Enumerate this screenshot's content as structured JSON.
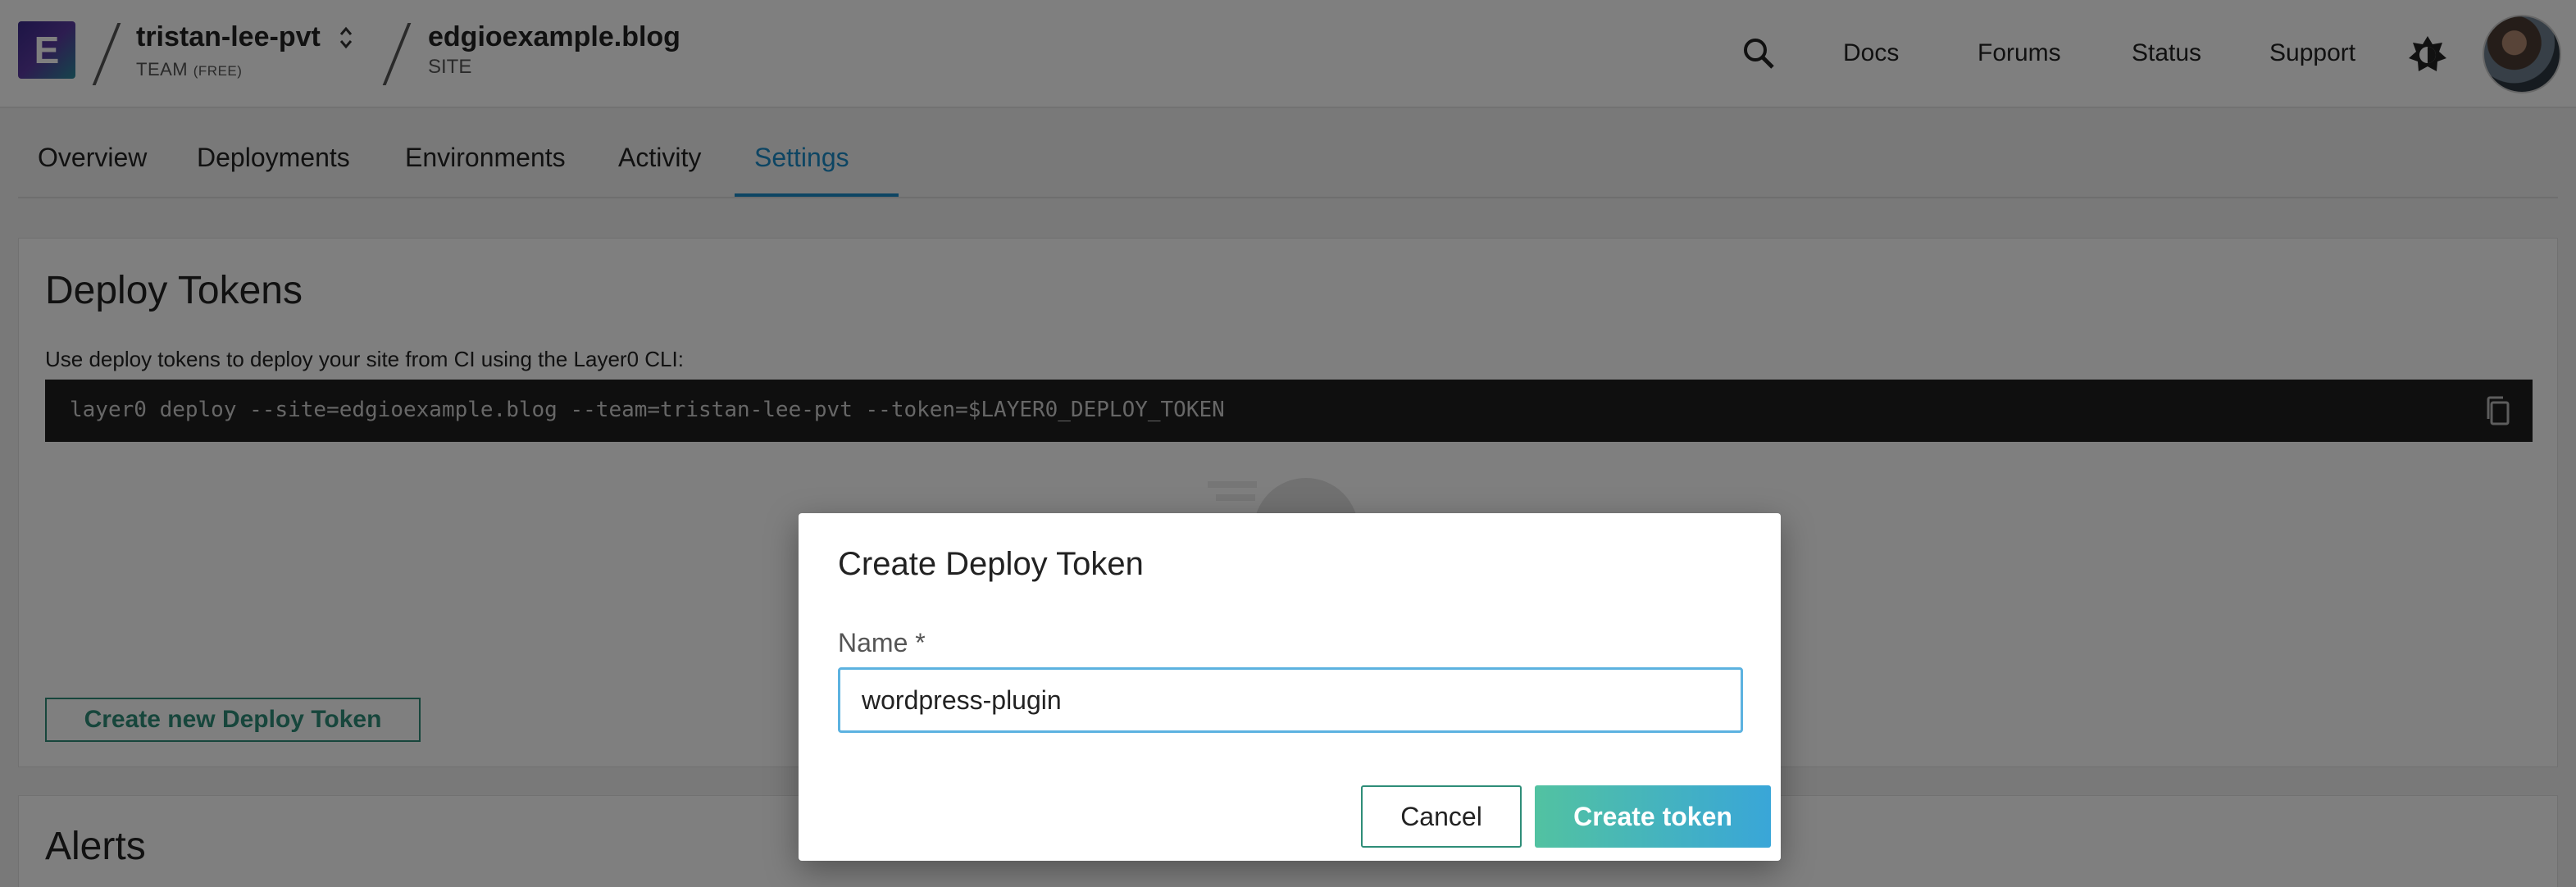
{
  "header": {
    "logo_letter": "E",
    "team_name": "tristan-lee-pvt",
    "team_sub": "TEAM",
    "team_plan": "(FREE)",
    "site_name": "edgioexample.blog",
    "site_sub": "SITE",
    "links": [
      "Docs",
      "Forums",
      "Status",
      "Support"
    ],
    "icons": {
      "search": "search-icon",
      "theme": "theme-toggle-icon",
      "switch": "chevron-updown-icon"
    }
  },
  "tabs": [
    {
      "label": "Overview",
      "active": false
    },
    {
      "label": "Deployments",
      "active": false
    },
    {
      "label": "Environments",
      "active": false
    },
    {
      "label": "Activity",
      "active": false
    },
    {
      "label": "Settings",
      "active": true
    }
  ],
  "deploy_tokens": {
    "title": "Deploy Tokens",
    "description": "Use deploy tokens to deploy your site from CI using the Layer0 CLI:",
    "command": "layer0 deploy --site=edgioexample.blog --team=tristan-lee-pvt --token=$LAYER0_DEPLOY_TOKEN",
    "create_button": "Create new Deploy Token"
  },
  "alerts": {
    "title": "Alerts"
  },
  "modal": {
    "title": "Create Deploy Token",
    "name_label": "Name *",
    "name_value": "wordpress-plugin",
    "cancel_label": "Cancel",
    "submit_label": "Create token"
  },
  "colors": {
    "accent": "#1b8ac6",
    "green": "#2e8d78",
    "gradient_start": "#52c2a1",
    "gradient_end": "#39a6d8"
  }
}
